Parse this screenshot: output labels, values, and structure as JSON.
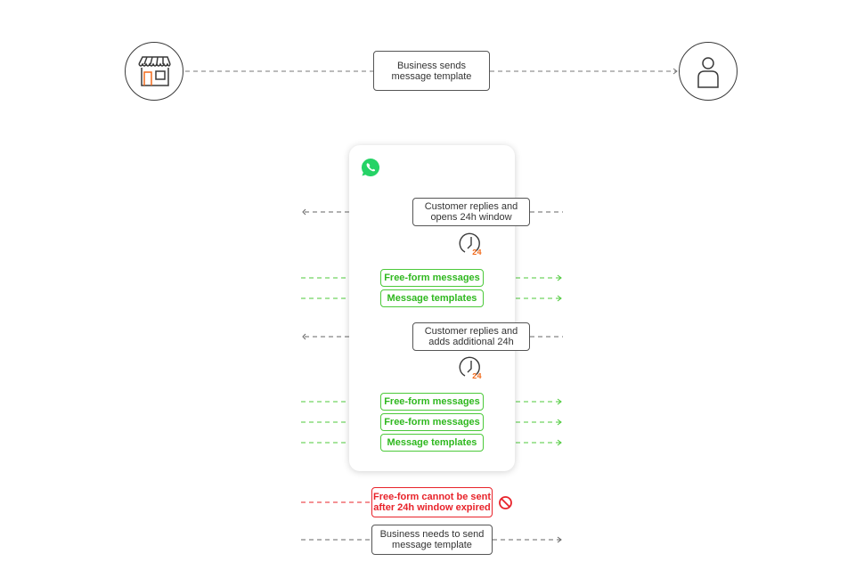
{
  "header": {
    "business_label": [
      "Business sends",
      "message template"
    ],
    "business_icon": "storefront-icon",
    "customer_icon": "user-icon"
  },
  "phone": {
    "app_icon": "whatsapp-icon",
    "events": [
      {
        "type": "customer",
        "lines": [
          "Customer replies and",
          "opens 24h window"
        ],
        "icon": "clock-24h-icon"
      },
      {
        "type": "allowed",
        "label": "Free-form messages"
      },
      {
        "type": "allowed",
        "label": "Message templates"
      },
      {
        "type": "customer",
        "lines": [
          "Customer replies and",
          "adds additional 24h"
        ],
        "icon": "clock-24h-icon"
      },
      {
        "type": "allowed",
        "label": "Free-form messages"
      },
      {
        "type": "allowed",
        "label": "Free-form messages"
      },
      {
        "type": "allowed",
        "label": "Message templates"
      }
    ]
  },
  "footer": {
    "blocked": [
      "Free-form cannot be sent",
      "after 24h window expired"
    ],
    "blocked_icon": "prohibited-icon",
    "required": [
      "Business needs to send",
      "message template"
    ]
  },
  "clock_label": "24",
  "colors": {
    "green": "#4cc93a",
    "red": "#e8232a",
    "orange": "#f26a1b",
    "dark": "#3a3a3a",
    "whatsapp": "#25d366"
  }
}
